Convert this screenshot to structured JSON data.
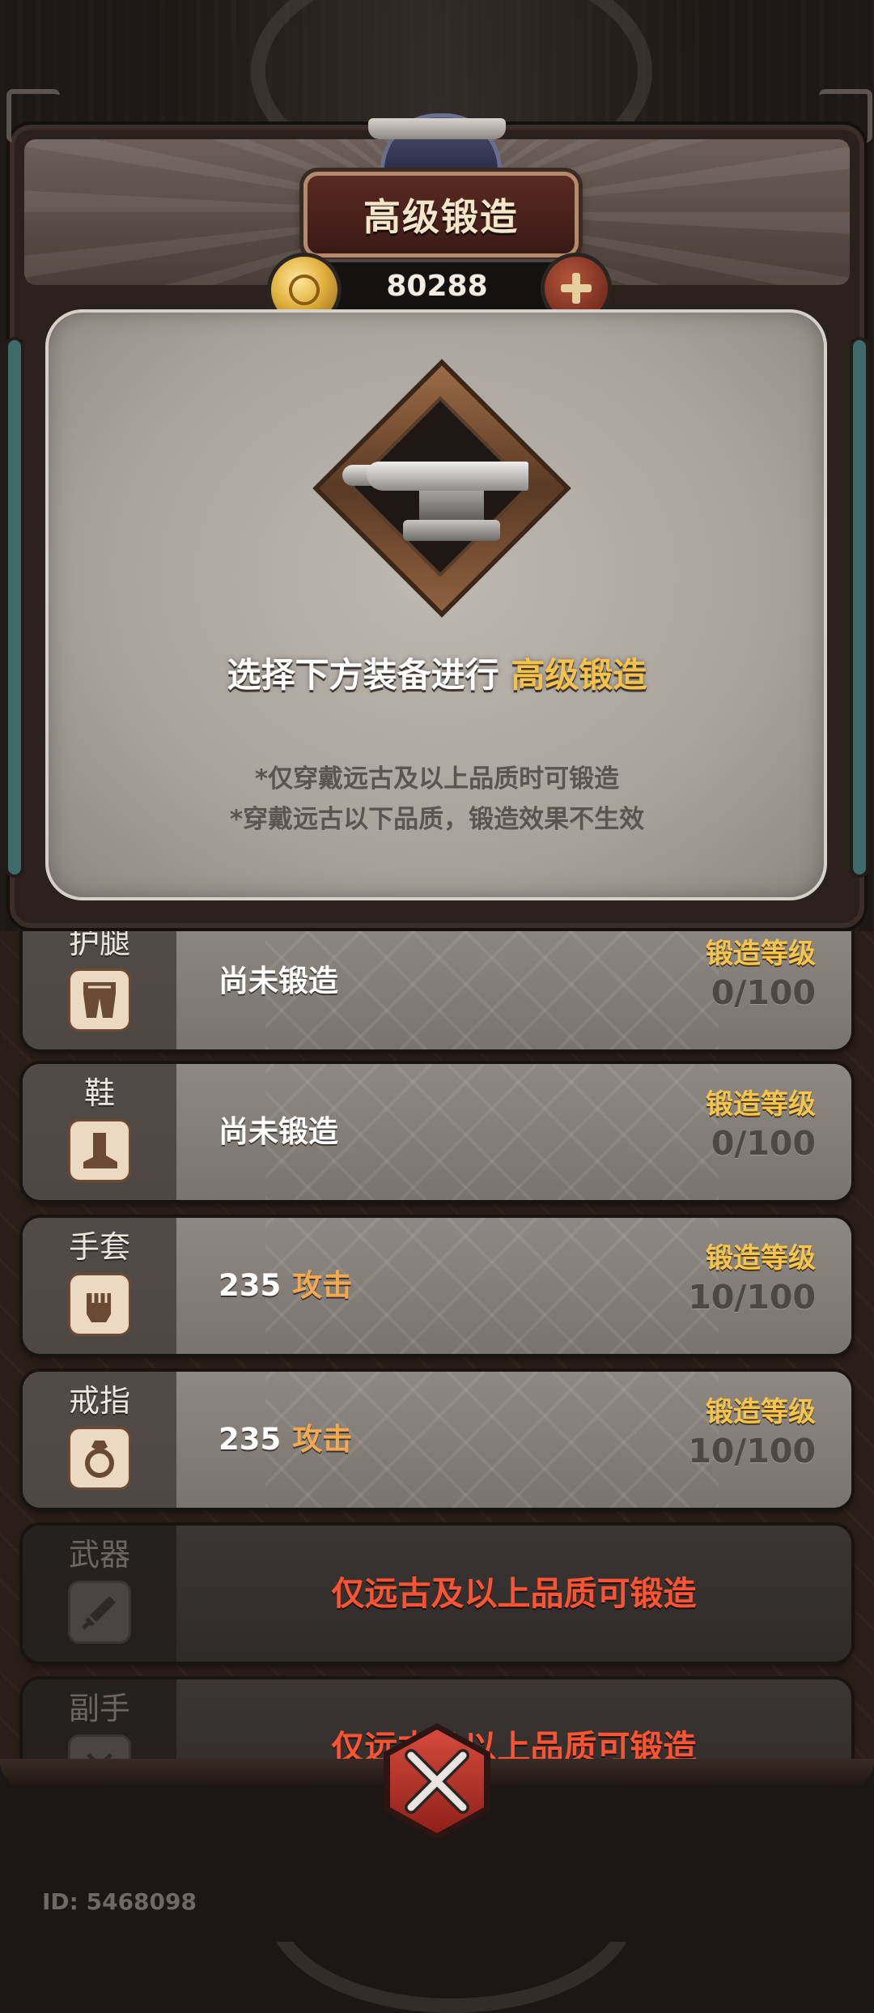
{
  "header": {
    "title": "高级锻造",
    "currency": {
      "icon": "gold-coin-icon",
      "value": "80288",
      "add_icon": "plus-icon"
    }
  },
  "intro": {
    "emblem_icon": "anvil-icon",
    "instruction_prefix": "选择下方装备进行",
    "instruction_highlight": "高级锻造",
    "note_1": "*仅穿戴远古及以上品质时可锻造",
    "note_2": "*穿戴远古以下品质，锻造效果不生效"
  },
  "items": [
    {
      "slot": "护腿",
      "icon": "leg-armor-icon",
      "status": "尚未锻造",
      "level_label": "锻造等级",
      "level": "0/100"
    },
    {
      "slot": "鞋",
      "icon": "boot-icon",
      "status": "尚未锻造",
      "level_label": "锻造等级",
      "level": "0/100"
    },
    {
      "slot": "手套",
      "icon": "fist-icon",
      "value": "235",
      "bonus": "攻击",
      "level_label": "锻造等级",
      "level": "10/100"
    },
    {
      "slot": "戒指",
      "icon": "ring-icon",
      "value": "235",
      "bonus": "攻击",
      "level_label": "锻造等级",
      "level": "10/100"
    },
    {
      "slot": "武器",
      "icon": "sword-icon",
      "locked_text": "仅远古及以上品质可锻造"
    },
    {
      "slot": "副手",
      "icon": "offhand-icon",
      "locked_text": "仅远古及以上品质可锻造"
    }
  ],
  "close_icon": "crossed-swords-close-icon",
  "footer": {
    "user_id": "ID: 5468098"
  },
  "colors": {
    "highlight": "#f7c24a",
    "bonus": "#f5a94e",
    "locked": "#ff5433",
    "level_label": "#f4c64d"
  }
}
